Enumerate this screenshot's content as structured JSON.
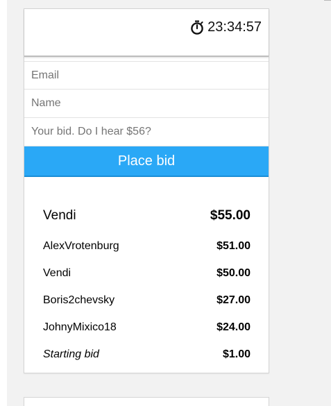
{
  "timer": {
    "icon": "stopwatch-icon",
    "time": "23:34:57"
  },
  "form": {
    "email_placeholder": "Email",
    "name_placeholder": "Name",
    "bid_placeholder": "Your bid. Do I hear $56?",
    "submit_label": "Place bid"
  },
  "bids": {
    "top": {
      "bidder": "Vendi",
      "amount": "$55.00"
    },
    "history": [
      {
        "bidder": "AlexVrotenburg",
        "amount": "$51.00"
      },
      {
        "bidder": "Vendi",
        "amount": "$50.00"
      },
      {
        "bidder": "Boris2chevsky",
        "amount": "$27.00"
      },
      {
        "bidder": "JohnyMixico18",
        "amount": "$24.00"
      }
    ],
    "starting": {
      "label": "Starting bid",
      "amount": "$1.00"
    }
  },
  "colors": {
    "accent": "#2aa8f6",
    "background": "#f2f2f2",
    "card": "#ffffff"
  }
}
